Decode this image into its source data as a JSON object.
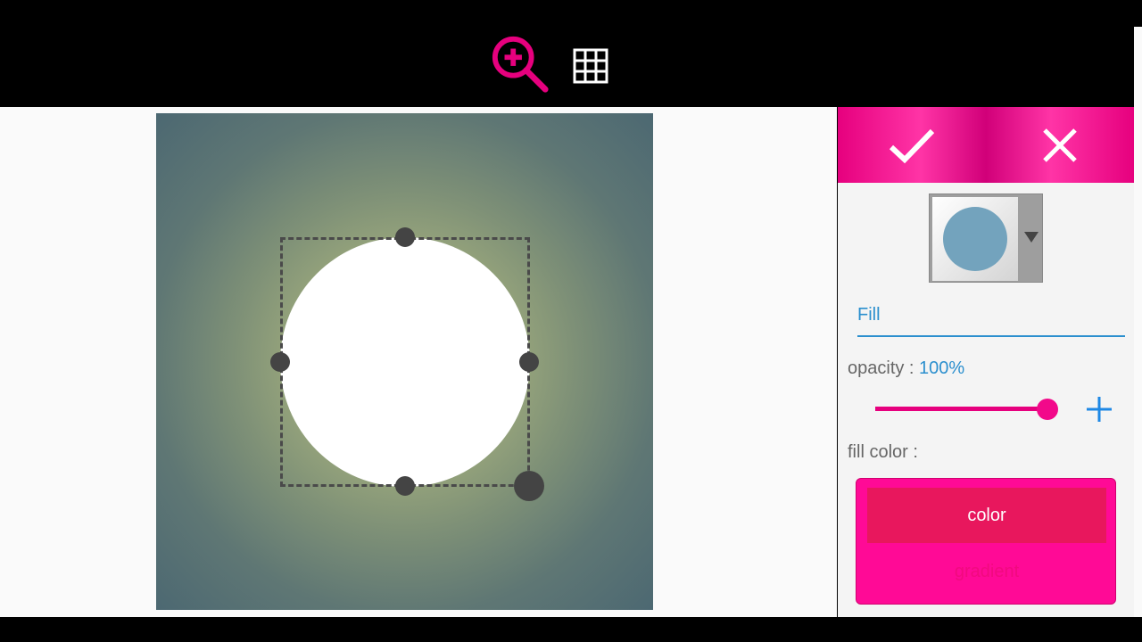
{
  "toolbar": {
    "zoom_icon": "zoom-in-icon",
    "grid_icon": "grid-icon",
    "accent_color": "#e6007e"
  },
  "canvas": {
    "shape": "circle",
    "shape_color": "#ffffff",
    "background_gradient": [
      "#b9c38a",
      "#4c6872"
    ]
  },
  "panel": {
    "confirm_icon": "check-icon",
    "cancel_icon": "close-icon",
    "shape_preview_icon": "circle-shape-icon",
    "shape_preview_color": "#73a3bd",
    "tab_fill": "Fill",
    "opacity_label": "opacity : ",
    "opacity_value": "100%",
    "opacity_fraction": 1.0,
    "fill_color_label": "fill color :",
    "color_option": "color",
    "gradient_option": "gradient",
    "fill_color": "#ff0a96"
  }
}
